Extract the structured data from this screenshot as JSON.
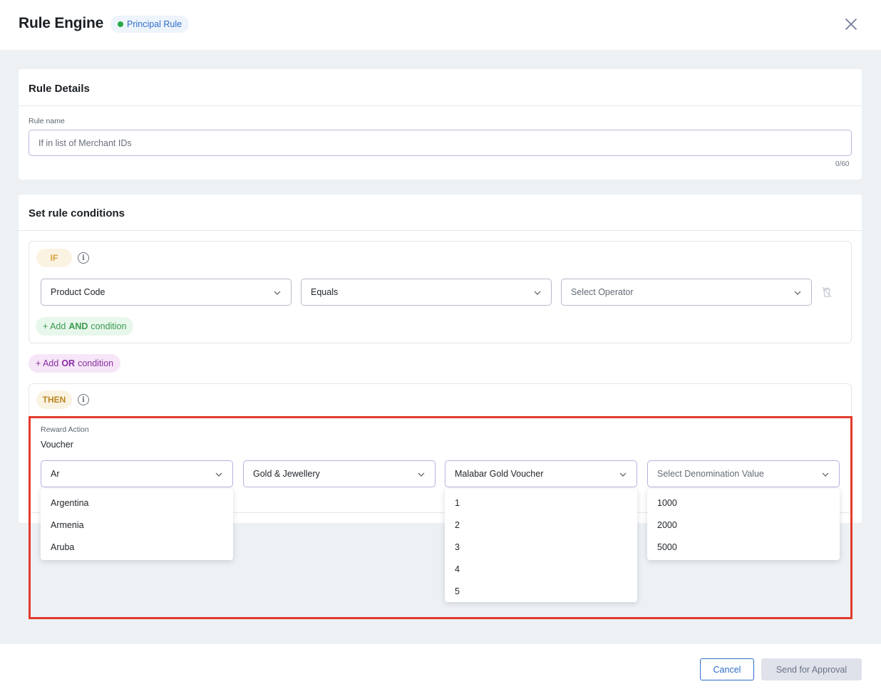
{
  "header": {
    "title": "Rule Engine",
    "badge": "Principal Rule",
    "badge_color": "#27a845"
  },
  "rule_details": {
    "heading": "Rule Details",
    "rule_name_label": "Rule name",
    "rule_name_placeholder": "If in list of Merchant IDs",
    "counter": "0/60"
  },
  "conditions": {
    "heading": "Set rule conditions",
    "if_label": "IF",
    "info_icon": "i",
    "product_code": "Product Code",
    "operator_equals": "Equals",
    "select_operator": "Select Operator",
    "add_and_prefix": "+ Add",
    "add_and_keyword": "AND",
    "add_and_suffix": "condition",
    "add_or_prefix": "+ Add",
    "add_or_keyword": "OR",
    "add_or_suffix": "condition",
    "then_label": "THEN",
    "reward_action_label": "Reward Action",
    "reward_action_value": "Voucher",
    "country_value": "Ar",
    "category_value": "Gold & Jewellery",
    "voucher_value": "Malabar Gold Voucher",
    "denomination_placeholder": "Select Denomination Value",
    "country_options": [
      "Argentina",
      "Armenia",
      "Aruba"
    ],
    "quantity_options": [
      "1",
      "2",
      "3",
      "4",
      "5"
    ],
    "denomination_options": [
      "1000",
      "2000",
      "5000"
    ]
  },
  "footer": {
    "cancel": "Cancel",
    "send": "Send for Approval"
  },
  "colors": {
    "accent": "#2f6ec9",
    "highlight": "#e23b2d"
  }
}
